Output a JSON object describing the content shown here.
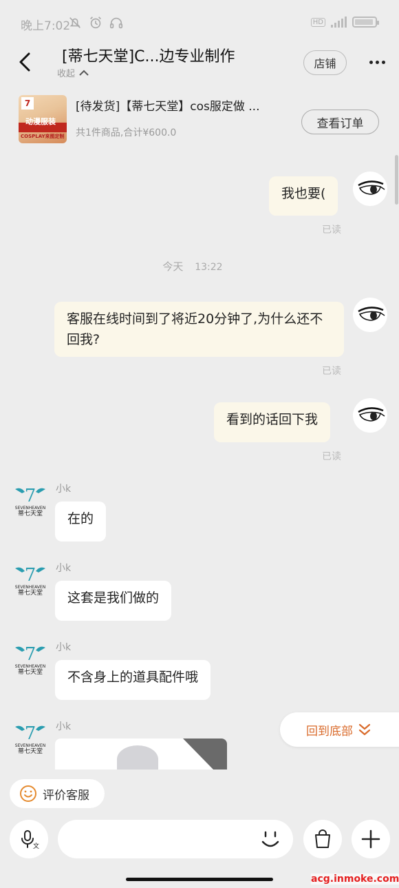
{
  "status_bar": {
    "time": "晚上7:02",
    "hd": "HD"
  },
  "header": {
    "title": "[蒂七天堂]C...边专业制作",
    "collapse_label": "收起",
    "shop_button": "店铺"
  },
  "order": {
    "thumb_text_main": "动漫服装",
    "thumb_text_sub": "COSPLAY来图定制",
    "thumb_logo": "7",
    "title": "[待发货]【蒂七天堂】cos服定做 ...",
    "summary": "共1件商品,合计¥600.0",
    "view_button": "查看订单"
  },
  "messages": {
    "m1": {
      "text": "我也要(",
      "read": "已读"
    },
    "timestamp_day": "今天",
    "timestamp_time": "13:22",
    "m2": {
      "text": "客服在线时间到了将近20分钟了,为什么还不回我?",
      "read": "已读"
    },
    "m3": {
      "text": "看到的话回下我",
      "read": "已读"
    },
    "shop_sender": "小k",
    "shop_logo_brand": "SEVENHEAVEN",
    "shop_logo_cn": "蒂七天堂",
    "r1": "在的",
    "r2": "这套是我们做的",
    "r3": "不含身上的道具配件哦"
  },
  "scroll_bottom_label": "回到底部",
  "rate_label": "评价客服",
  "input": {
    "placeholder": ""
  },
  "watermark": "acg.inmoke.com",
  "colors": {
    "accent": "#d96a2a",
    "outgoing_bubble": "#fbf7e9",
    "background": "#ededed",
    "shop_teal": "#2a9db0"
  }
}
